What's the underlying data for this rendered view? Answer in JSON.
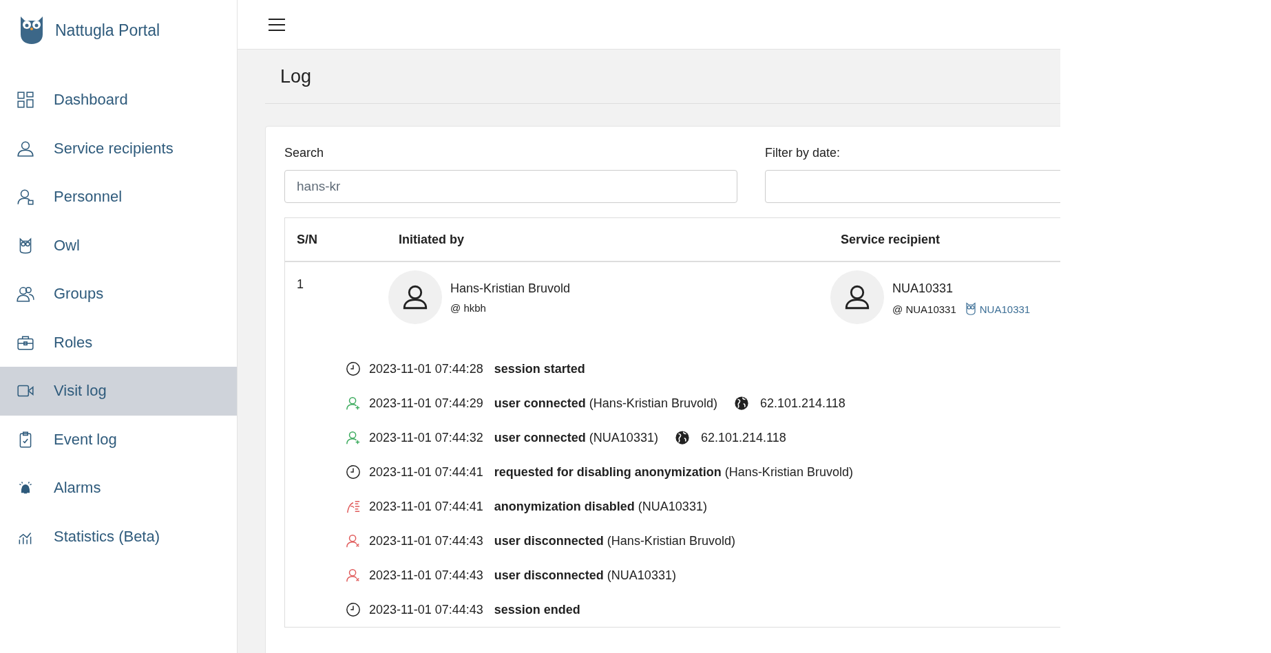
{
  "brand": {
    "name": "Nattugla Portal"
  },
  "sidebar": {
    "items": [
      {
        "kind": "dashboard",
        "label": "Dashboard",
        "selected": false
      },
      {
        "kind": "recipients",
        "label": "Service recipients",
        "selected": false
      },
      {
        "kind": "personnel",
        "label": "Personnel",
        "selected": false
      },
      {
        "kind": "owl",
        "label": "Owl",
        "selected": false
      },
      {
        "kind": "groups",
        "label": "Groups",
        "selected": false
      },
      {
        "kind": "roles",
        "label": "Roles",
        "selected": false
      },
      {
        "kind": "visit",
        "label": "Visit log",
        "selected": true
      },
      {
        "kind": "event",
        "label": "Event log",
        "selected": false
      },
      {
        "kind": "alarms",
        "label": "Alarms",
        "selected": false
      },
      {
        "kind": "stats",
        "label": "Statistics (Beta)",
        "selected": false
      }
    ]
  },
  "page": {
    "title": "Log"
  },
  "search": {
    "label": "Search",
    "value": "hans-kr"
  },
  "date_filter": {
    "label": "Filter by date:"
  },
  "table": {
    "columns": [
      "S/N",
      "Initiated by",
      "Service recipient"
    ],
    "rows": [
      {
        "sn": "1",
        "initiated_by": {
          "name": "Hans-Kristian Bruvold",
          "username": "@ hkbh"
        },
        "service_recipient": {
          "name": "NUA10331",
          "username": "@ NUA10331",
          "owl": "NUA10331"
        },
        "events": [
          {
            "kind": "clock",
            "time": "2023-11-01 07:44:28",
            "text": "**session started**"
          },
          {
            "kind": "connect",
            "time": "2023-11-01 07:44:29",
            "text": "**user connected** (Hans-Kristian Bruvold)",
            "ip": "62.101.214.118"
          },
          {
            "kind": "connect",
            "time": "2023-11-01 07:44:32",
            "text": "**user connected** (NUA10331)",
            "ip": "62.101.214.118"
          },
          {
            "kind": "clock",
            "time": "2023-11-01 07:44:41",
            "text": "**requested for disabling anonymization** (Hans-Kristian Bruvold)"
          },
          {
            "kind": "anon",
            "time": "2023-11-01 07:44:41",
            "text": "**anonymization disabled** (NUA10331)"
          },
          {
            "kind": "disconnect",
            "time": "2023-11-01 07:44:43",
            "text": "**user disconnected** (Hans-Kristian Bruvold)"
          },
          {
            "kind": "disconnect",
            "time": "2023-11-01 07:44:43",
            "text": "**user disconnected** (NUA10331)"
          },
          {
            "kind": "clock",
            "time": "2023-11-01 07:44:43",
            "text": "**session ended**"
          }
        ]
      }
    ]
  }
}
